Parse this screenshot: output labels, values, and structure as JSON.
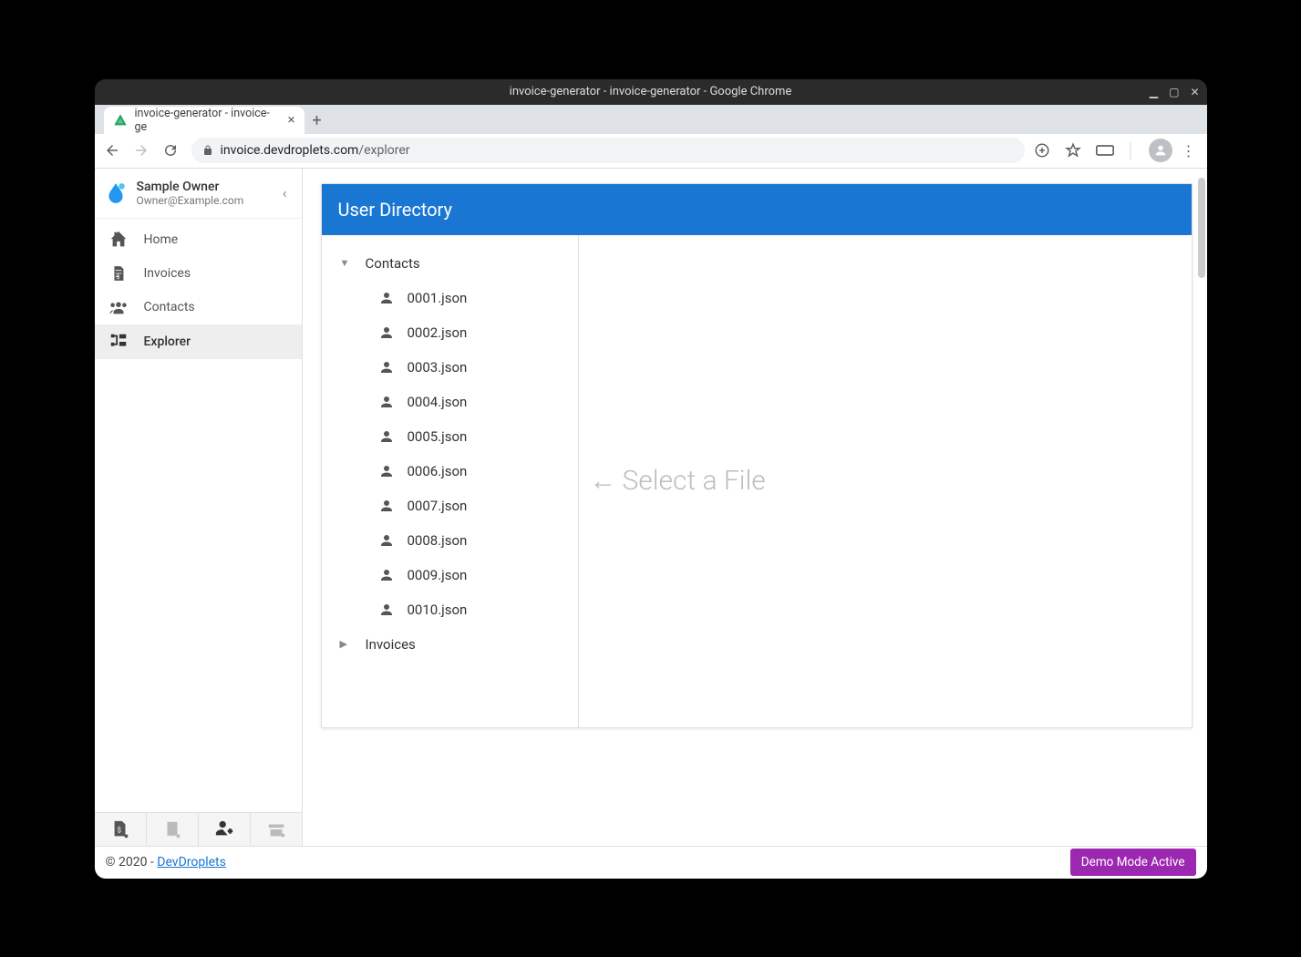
{
  "window": {
    "title": "invoice-generator - invoice-generator - Google Chrome"
  },
  "browser": {
    "tab_label": "invoice-generator - invoice-ge",
    "url_host": "invoice.devdroplets.com",
    "url_path": "/explorer"
  },
  "sidebar": {
    "owner_name": "Sample Owner",
    "owner_email": "Owner@Example.com",
    "items": [
      {
        "label": "Home"
      },
      {
        "label": "Invoices"
      },
      {
        "label": "Contacts"
      },
      {
        "label": "Explorer"
      }
    ]
  },
  "panel": {
    "title": "User Directory",
    "placeholder": "Select a File",
    "folders": [
      {
        "label": "Contacts",
        "expanded": true,
        "files": [
          "0001.json",
          "0002.json",
          "0003.json",
          "0004.json",
          "0005.json",
          "0006.json",
          "0007.json",
          "0008.json",
          "0009.json",
          "0010.json"
        ]
      },
      {
        "label": "Invoices",
        "expanded": false,
        "files": []
      }
    ]
  },
  "footer": {
    "copyright_prefix": "© 2020 - ",
    "link_label": "DevDroplets",
    "demo_label": "Demo Mode Active"
  }
}
